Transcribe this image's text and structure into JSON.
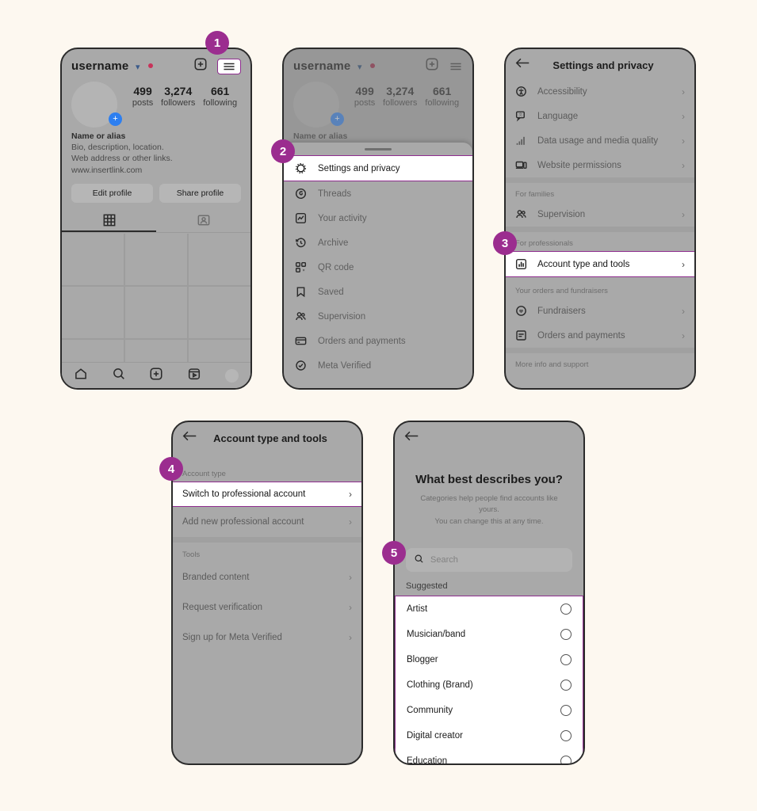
{
  "theme": {
    "page_bg": "#fdf8f0",
    "phone_bg": "#a9a9a9",
    "accent": "#9b2d8f",
    "highlight_border": "#8e2d8e"
  },
  "steps": [
    {
      "number": "1"
    },
    {
      "number": "2"
    },
    {
      "number": "3"
    },
    {
      "number": "4"
    },
    {
      "number": "5"
    }
  ],
  "profile": {
    "username": "username",
    "stats": [
      {
        "number": "499",
        "label": "posts"
      },
      {
        "number": "3,274",
        "label": "followers"
      },
      {
        "number": "661",
        "label": "following"
      }
    ],
    "bio_name": "Name or alias",
    "bio_line1": "Bio, description, location.",
    "bio_line2": "Web address or other links.",
    "bio_link": "www.insertlink.com",
    "edit_profile": "Edit profile",
    "share_profile": "Share profile"
  },
  "menu_sheet": {
    "items": [
      {
        "label": "Settings and privacy",
        "icon": "gear-icon"
      },
      {
        "label": "Threads",
        "icon": "threads-icon"
      },
      {
        "label": "Your activity",
        "icon": "activity-icon"
      },
      {
        "label": "Archive",
        "icon": "archive-clock-icon"
      },
      {
        "label": "QR code",
        "icon": "qr-code-icon"
      },
      {
        "label": "Saved",
        "icon": "bookmark-icon"
      },
      {
        "label": "Supervision",
        "icon": "people-icon"
      },
      {
        "label": "Orders and payments",
        "icon": "card-icon"
      },
      {
        "label": "Meta Verified",
        "icon": "verified-badge-icon"
      }
    ]
  },
  "settings_privacy": {
    "title": "Settings and privacy",
    "rows_top": [
      {
        "label": "Accessibility",
        "icon": "accessibility-icon"
      },
      {
        "label": "Language",
        "icon": "language-icon"
      },
      {
        "label": "Data usage and media quality",
        "icon": "bars-signal-icon"
      },
      {
        "label": "Website permissions",
        "icon": "website-icon"
      }
    ],
    "header_families": "For families",
    "rows_families": [
      {
        "label": "Supervision",
        "icon": "people-icon"
      }
    ],
    "header_professionals": "For professionals",
    "rows_professionals": [
      {
        "label": "Account type and tools",
        "icon": "chart-box-icon",
        "highlighted": true
      }
    ],
    "header_orders": "Your orders and fundraisers",
    "rows_orders": [
      {
        "label": "Fundraisers",
        "icon": "heart-circle-icon"
      },
      {
        "label": "Orders and payments",
        "icon": "receipt-icon"
      }
    ],
    "header_more": "More info and support"
  },
  "account_type_tools": {
    "title": "Account type and tools",
    "header_account_type": "Account type",
    "rows_account": [
      {
        "label": "Switch to professional account",
        "highlighted": true
      },
      {
        "label": "Add new professional account",
        "highlighted": false
      }
    ],
    "header_tools": "Tools",
    "rows_tools": [
      {
        "label": "Branded content"
      },
      {
        "label": "Request verification"
      },
      {
        "label": "Sign up for Meta Verified"
      }
    ]
  },
  "categories": {
    "title": "What best describes you?",
    "subtitle_line1": "Categories help people find accounts like yours.",
    "subtitle_line2": "You can change this at any time.",
    "search_placeholder": "Search",
    "suggested_label": "Suggested",
    "items": [
      "Artist",
      "Musician/band",
      "Blogger",
      "Clothing (Brand)",
      "Community",
      "Digital creator",
      "Education"
    ]
  }
}
